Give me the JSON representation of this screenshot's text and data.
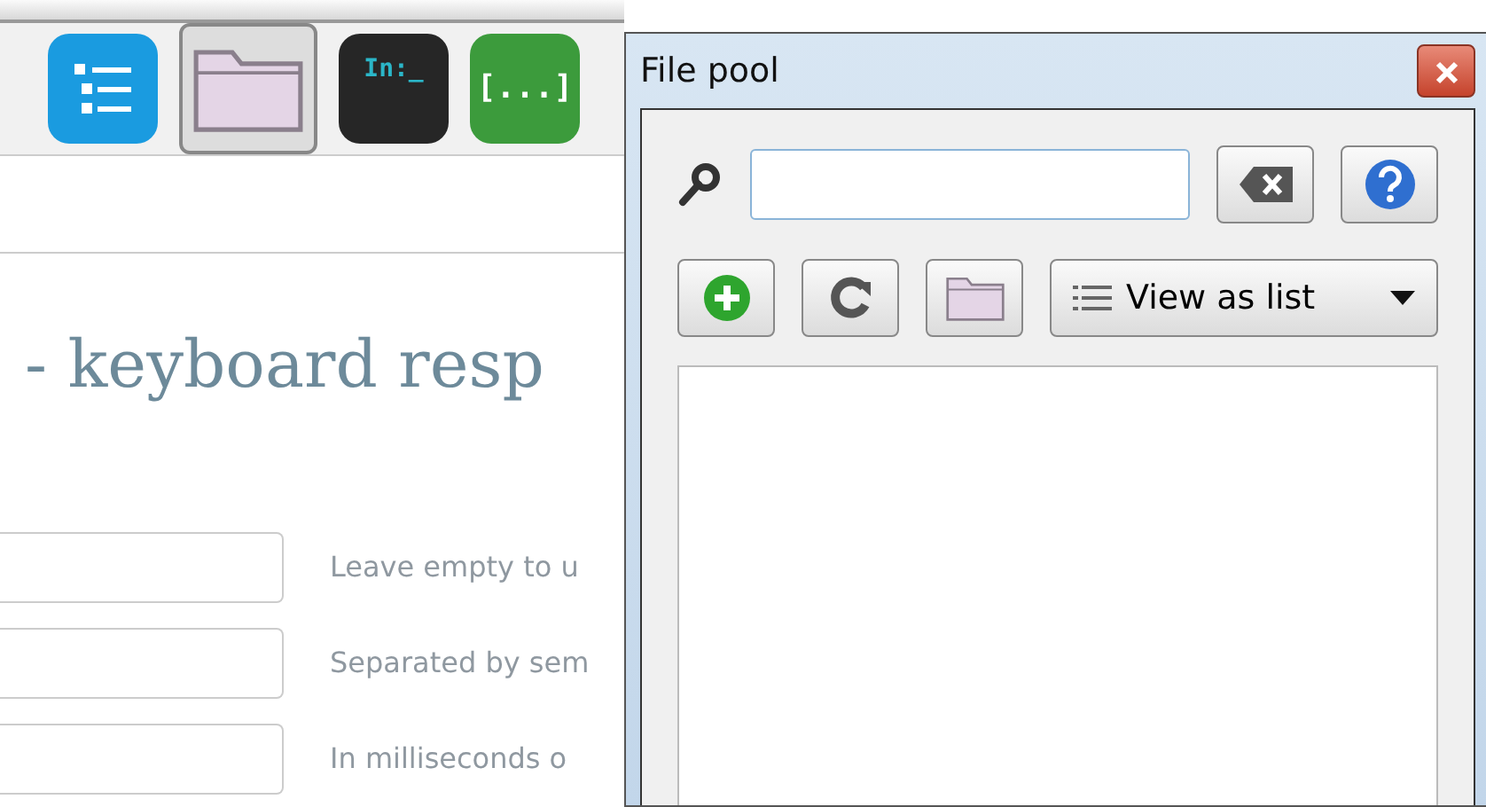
{
  "toolbar": {
    "buttons": [
      {
        "kind": "list",
        "selected": false
      },
      {
        "kind": "folder",
        "selected": true
      },
      {
        "kind": "terminal",
        "label": "In:_",
        "selected": false
      },
      {
        "kind": "brackets",
        "label": "[...]",
        "selected": false
      }
    ]
  },
  "page": {
    "heading": "- keyboard resp",
    "fields": [
      {
        "hint": "Leave empty to u"
      },
      {
        "hint": "Separated by sem"
      },
      {
        "hint": "In milliseconds o"
      }
    ]
  },
  "dialog": {
    "title": "File pool",
    "buttons": [
      {
        "kind": "add"
      },
      {
        "kind": "refresh"
      },
      {
        "kind": "folder"
      }
    ],
    "view_menu": {
      "label": "View as list"
    }
  }
}
